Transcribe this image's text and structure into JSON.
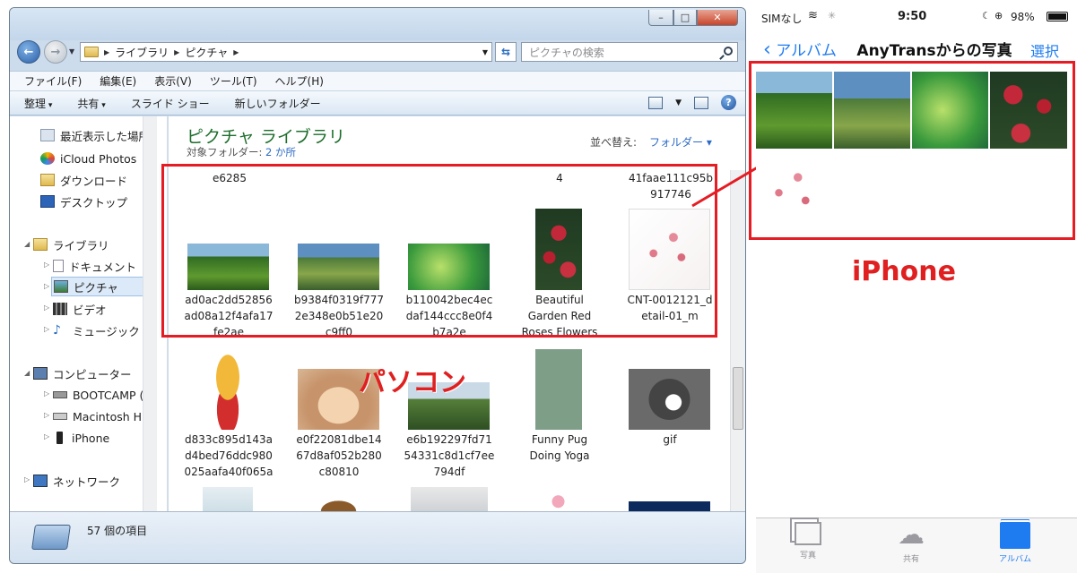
{
  "explorer": {
    "address": {
      "crumbs": [
        "ライブラリ",
        "ピクチャ"
      ]
    },
    "search_placeholder": "ピクチャの検索",
    "menu": [
      "ファイル(F)",
      "編集(E)",
      "表示(V)",
      "ツール(T)",
      "ヘルプ(H)"
    ],
    "toolbar": {
      "organize": "整理",
      "share": "共有",
      "slideshow": "スライド ショー",
      "new_folder": "新しいフォルダー"
    },
    "sidebar": {
      "recent": "最近表示した場所",
      "icloud": "iCloud Photos",
      "downloads": "ダウンロード",
      "desktop": "デスクトップ",
      "libraries": "ライブラリ",
      "documents": "ドキュメント",
      "pictures": "ピクチャ",
      "videos": "ビデオ",
      "music": "ミュージック",
      "computer": "コンピューター",
      "bootcamp": "BOOTCAMP (C:",
      "macintosh": "Macintosh HD (",
      "iphone": "iPhone",
      "network": "ネットワーク"
    },
    "content": {
      "title": "ピクチャ ライブラリ",
      "subtitle_prefix": "対象フォルダー:",
      "subtitle_link": "2 か所",
      "sort_label": "並べ替え:",
      "sort_value": "フォルダー ▾",
      "top_partial": [
        "e6285",
        "4",
        "41faae111c95b\n917746"
      ],
      "row1": [
        "ad0ac2dd52856\nad08a12f4afa17\nfe2ae",
        "b9384f0319f777\n2e348e0b51e20\nc9ff0",
        "b110042bec4ec\ndaf144ccc8e0f4\nb7a2e",
        "Beautiful\nGarden Red\nRoses Flowers",
        "CNT-0012121_d\netail-01_m"
      ],
      "row2": [
        "d833c895d143a\nd4bed76ddc980\n025aafa40f065a",
        "e0f22081dbe14\n67d8af052b280\nc80810",
        "e6b192297fd71\n54331c8d1cf7ee\n794df",
        "Funny Pug\nDoing Yoga",
        "gif"
      ]
    },
    "status": "57 個の項目"
  },
  "annotations": {
    "pc": "パソコン",
    "iphone": "iPhone"
  },
  "phone": {
    "carrier": "SIMなし",
    "time": "9:50",
    "battery": "98%",
    "back": "アルバム",
    "title": "AnyTransからの写真",
    "select": "選択",
    "tabs": [
      "写真",
      "共有",
      "アルバム"
    ]
  }
}
